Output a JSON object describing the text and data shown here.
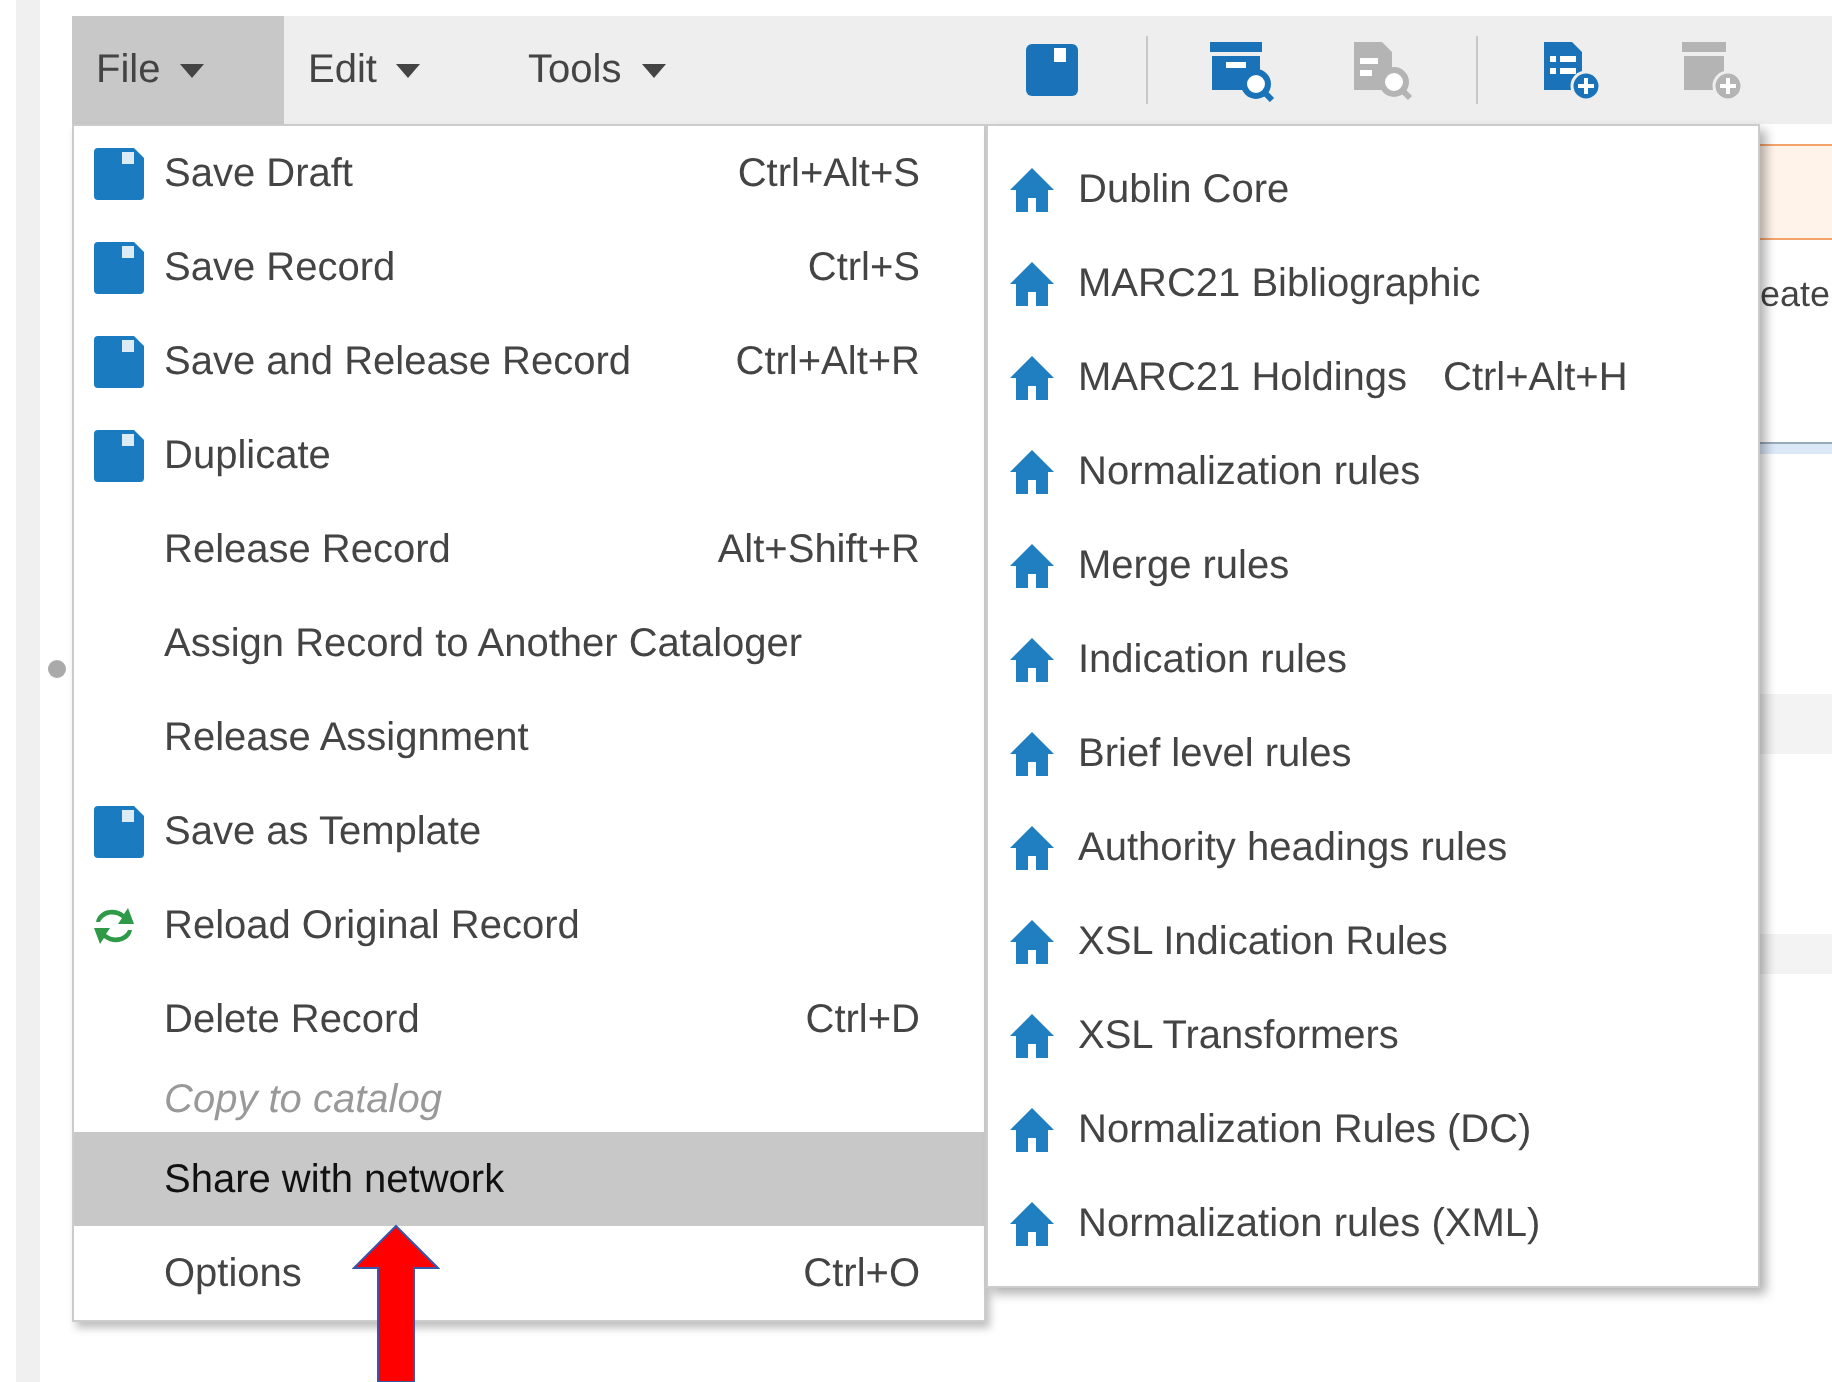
{
  "menubar": [
    {
      "label": "File",
      "selected": true
    },
    {
      "label": "Edit",
      "selected": false
    },
    {
      "label": "Tools",
      "selected": false
    }
  ],
  "toolbar": [
    {
      "kind": "save",
      "disabled": false
    },
    {
      "kind": "separator"
    },
    {
      "kind": "archive-search",
      "disabled": false
    },
    {
      "kind": "document-search",
      "disabled": true
    },
    {
      "kind": "separator"
    },
    {
      "kind": "document-add",
      "disabled": false
    },
    {
      "kind": "archive-add",
      "disabled": true
    }
  ],
  "file_menu": [
    {
      "label": "Save Draft",
      "shortcut": "Ctrl+Alt+S",
      "kind": "save",
      "disabled": false,
      "selected": false
    },
    {
      "label": "Save Record",
      "shortcut": "Ctrl+S",
      "kind": "save",
      "disabled": false,
      "selected": false
    },
    {
      "label": "Save and Release Record",
      "shortcut": "Ctrl+Alt+R",
      "kind": "save",
      "disabled": false,
      "selected": false
    },
    {
      "label": "Duplicate",
      "kind": "save",
      "disabled": false,
      "selected": false
    },
    {
      "label": "Release Record",
      "shortcut": "Alt+Shift+R",
      "disabled": false,
      "selected": false
    },
    {
      "label": "Assign Record to Another Cataloger",
      "disabled": false,
      "selected": false
    },
    {
      "label": "Release Assignment",
      "disabled": false,
      "selected": false
    },
    {
      "label": "Save as Template",
      "kind": "save",
      "disabled": false,
      "selected": false
    },
    {
      "label": "Reload Original Record",
      "kind": "reload",
      "disabled": false,
      "selected": false
    },
    {
      "label": "Delete Record",
      "shortcut": "Ctrl+D",
      "disabled": false,
      "selected": false
    },
    {
      "label": "Copy to catalog",
      "disabled": true,
      "selected": false
    },
    {
      "label": "Share with network",
      "disabled": false,
      "selected": true
    },
    {
      "label": "Options",
      "shortcut": "Ctrl+O",
      "disabled": false,
      "selected": false
    }
  ],
  "submenu": [
    {
      "label": "Dublin Core"
    },
    {
      "label": "MARC21 Bibliographic"
    },
    {
      "label": "MARC21 Holdings",
      "shortcut": "Ctrl+Alt+H"
    },
    {
      "label": "Normalization rules"
    },
    {
      "label": "Merge rules"
    },
    {
      "label": "Indication rules"
    },
    {
      "label": "Brief level rules"
    },
    {
      "label": "Authority headings rules"
    },
    {
      "label": "XSL Indication Rules"
    },
    {
      "label": "XSL Transformers"
    },
    {
      "label": "Normalization Rules (DC)"
    },
    {
      "label": "Normalization rules (XML)"
    }
  ],
  "background_text": "eate"
}
